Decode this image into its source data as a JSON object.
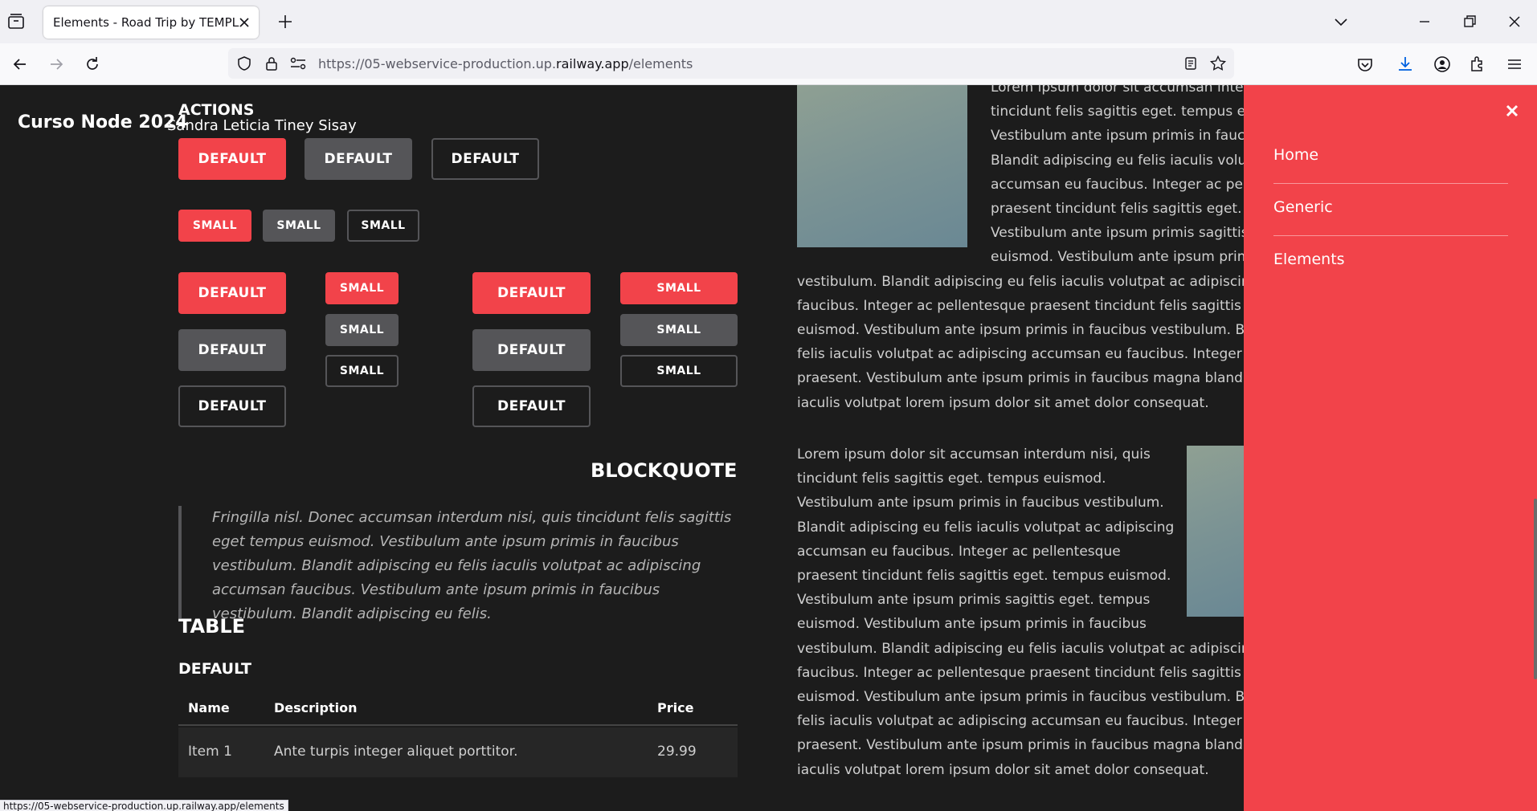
{
  "browser": {
    "tab_title": "Elements - Road Trip by TEMPLATED",
    "url_prefix": "https://05-webservice-production.up.",
    "url_domain": "railway.app",
    "url_path": "/elements",
    "status_url": "https://05-webservice-production.up.railway.app/elements"
  },
  "header": {
    "brand": "Curso Node 2024",
    "author": "Sandra Leticia Tiney Sisay"
  },
  "actions": {
    "title": "ACTIONS",
    "default_label": "DEFAULT",
    "small_label": "SMALL"
  },
  "blockquote": {
    "title": "BLOCKQUOTE",
    "text": "Fringilla nisl. Donec accumsan interdum nisi, quis tincidunt felis sagittis eget tempus euismod. Vestibulum ante ipsum primis in faucibus vestibulum. Blandit adipiscing eu felis iaculis volutpat ac adipiscing accumsan faucibus. Vestibulum ante ipsum primis in faucibus vestibulum. Blandit adipiscing eu felis."
  },
  "table": {
    "title": "TABLE",
    "subtitle": "DEFAULT",
    "headers": [
      "Name",
      "Description",
      "Price"
    ],
    "rows": [
      {
        "name": "Item 1",
        "description": "Ante turpis integer aliquet porttitor.",
        "price": "29.99"
      }
    ]
  },
  "paragraph1": [
    "Lorem ipsum dolor sit accumsan interdum nisi, quis",
    "tincidunt felis sagittis eget. tempus euismod.",
    "Vestibulum ante ipsum primis in faucibus vestibulum.",
    "Blandit adipiscing eu felis iaculis volutpat ac adipiscing",
    "accumsan eu faucibus. Integer ac pellentesque",
    "praesent tincidunt felis sagittis eget. tempus euismod.",
    "Vestibulum ante ipsum primis sagittis eget. tempus",
    "euismod. Vestibulum ante ipsum primis in faucibus",
    "vestibulum. Blandit adipiscing eu felis iaculis volutpat ac adipiscing accumsan eu",
    "faucibus. Integer ac pellentesque praesent tincidunt felis sagittis eget. tempus",
    "euismod. Vestibulum ante ipsum primis in faucibus vestibulum. Blandit adipiscing eu",
    "felis iaculis volutpat ac adipiscing accumsan eu faucibus. Integer ac pellentesque",
    "praesent. Vestibulum ante ipsum primis in faucibus magna blandit adipiscing eu felis",
    "iaculis volutpat lorem ipsum dolor sit amet dolor consequat."
  ],
  "paragraph2": [
    "Lorem ipsum dolor sit accumsan interdum nisi, quis",
    "tincidunt felis sagittis eget. tempus euismod.",
    "Vestibulum ante ipsum primis in faucibus vestibulum.",
    "Blandit adipiscing eu felis iaculis volutpat ac adipiscing",
    "accumsan eu faucibus. Integer ac pellentesque",
    "praesent tincidunt felis sagittis eget. tempus euismod.",
    "Vestibulum ante ipsum primis sagittis eget. tempus",
    "euismod. Vestibulum ante ipsum primis in faucibus",
    "vestibulum. Blandit adipiscing eu felis iaculis volutpat ac adipiscing accumsan eu",
    "faucibus. Integer ac pellentesque praesent tincidunt felis sagittis eget. tempus",
    "euismod. Vestibulum ante ipsum primis in faucibus vestibulum. Blandit adipiscing eu",
    "felis iaculis volutpat ac adipiscing accumsan eu faucibus. Integer ac pellentesque",
    "praesent. Vestibulum ante ipsum primis in faucibus magna blandit adipiscing eu felis",
    "iaculis volutpat lorem ipsum dolor sit amet dolor consequat."
  ],
  "menu": {
    "items": [
      "Home",
      "Generic",
      "Elements"
    ]
  },
  "colors": {
    "accent": "#f2434a",
    "background": "#1c1c1c",
    "button_gray": "#555558"
  }
}
